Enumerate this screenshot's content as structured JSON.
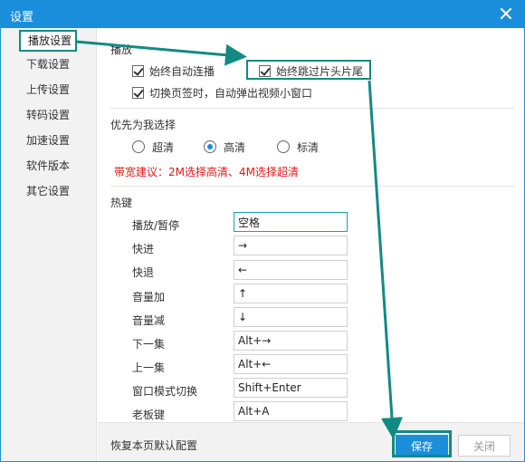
{
  "window": {
    "title": "设置"
  },
  "sidebar": {
    "items": [
      {
        "label": "播放设置"
      },
      {
        "label": "下载设置"
      },
      {
        "label": "上传设置"
      },
      {
        "label": "转码设置"
      },
      {
        "label": "加速设置"
      },
      {
        "label": "软件版本"
      },
      {
        "label": "其它设置"
      }
    ]
  },
  "playback": {
    "title": "播放",
    "auto_continue": "始终自动连播",
    "skip_intro": "始终跳过片头片尾",
    "mini_window": "切换页签时，自动弹出视频小窗口"
  },
  "quality": {
    "title": "优先为我选择",
    "options": [
      {
        "label": "超清"
      },
      {
        "label": "高清"
      },
      {
        "label": "标清"
      }
    ],
    "selected": "高清",
    "advice": "带宽建议：2M选择高清、4M选择超清"
  },
  "hotkeys": {
    "title": "热键",
    "rows": [
      {
        "label": "播放/暂停",
        "value": "空格"
      },
      {
        "label": "快进",
        "value": "→"
      },
      {
        "label": "快退",
        "value": "←"
      },
      {
        "label": "音量加",
        "value": "↑"
      },
      {
        "label": "音量减",
        "value": "↓"
      },
      {
        "label": "下一集",
        "value": "Alt+→"
      },
      {
        "label": "上一集",
        "value": "Alt+←"
      },
      {
        "label": "窗口模式切换",
        "value": "Shift+Enter"
      },
      {
        "label": "老板键",
        "value": "Alt+A"
      }
    ]
  },
  "footer": {
    "restore": "恢复本页默认配置",
    "save": "保存",
    "close": "关闭"
  },
  "colors": {
    "titlebar": "#1a8edb",
    "highlight": "#128a84",
    "advice": "#e01818"
  }
}
